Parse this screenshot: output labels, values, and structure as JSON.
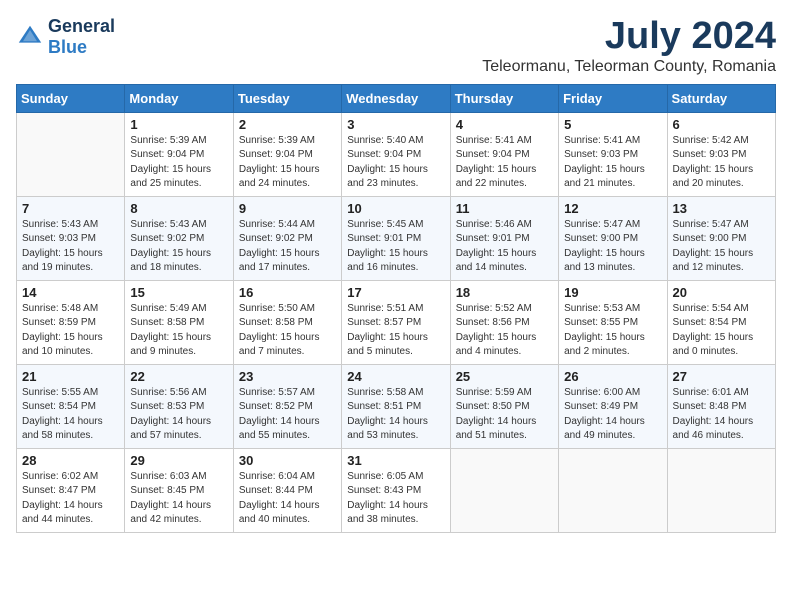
{
  "logo": {
    "general": "General",
    "blue": "Blue"
  },
  "title": "July 2024",
  "location": "Teleormanu, Teleorman County, Romania",
  "days_of_week": [
    "Sunday",
    "Monday",
    "Tuesday",
    "Wednesday",
    "Thursday",
    "Friday",
    "Saturday"
  ],
  "weeks": [
    [
      {
        "num": "",
        "info": ""
      },
      {
        "num": "1",
        "info": "Sunrise: 5:39 AM\nSunset: 9:04 PM\nDaylight: 15 hours\nand 25 minutes."
      },
      {
        "num": "2",
        "info": "Sunrise: 5:39 AM\nSunset: 9:04 PM\nDaylight: 15 hours\nand 24 minutes."
      },
      {
        "num": "3",
        "info": "Sunrise: 5:40 AM\nSunset: 9:04 PM\nDaylight: 15 hours\nand 23 minutes."
      },
      {
        "num": "4",
        "info": "Sunrise: 5:41 AM\nSunset: 9:04 PM\nDaylight: 15 hours\nand 22 minutes."
      },
      {
        "num": "5",
        "info": "Sunrise: 5:41 AM\nSunset: 9:03 PM\nDaylight: 15 hours\nand 21 minutes."
      },
      {
        "num": "6",
        "info": "Sunrise: 5:42 AM\nSunset: 9:03 PM\nDaylight: 15 hours\nand 20 minutes."
      }
    ],
    [
      {
        "num": "7",
        "info": "Sunrise: 5:43 AM\nSunset: 9:03 PM\nDaylight: 15 hours\nand 19 minutes."
      },
      {
        "num": "8",
        "info": "Sunrise: 5:43 AM\nSunset: 9:02 PM\nDaylight: 15 hours\nand 18 minutes."
      },
      {
        "num": "9",
        "info": "Sunrise: 5:44 AM\nSunset: 9:02 PM\nDaylight: 15 hours\nand 17 minutes."
      },
      {
        "num": "10",
        "info": "Sunrise: 5:45 AM\nSunset: 9:01 PM\nDaylight: 15 hours\nand 16 minutes."
      },
      {
        "num": "11",
        "info": "Sunrise: 5:46 AM\nSunset: 9:01 PM\nDaylight: 15 hours\nand 14 minutes."
      },
      {
        "num": "12",
        "info": "Sunrise: 5:47 AM\nSunset: 9:00 PM\nDaylight: 15 hours\nand 13 minutes."
      },
      {
        "num": "13",
        "info": "Sunrise: 5:47 AM\nSunset: 9:00 PM\nDaylight: 15 hours\nand 12 minutes."
      }
    ],
    [
      {
        "num": "14",
        "info": "Sunrise: 5:48 AM\nSunset: 8:59 PM\nDaylight: 15 hours\nand 10 minutes."
      },
      {
        "num": "15",
        "info": "Sunrise: 5:49 AM\nSunset: 8:58 PM\nDaylight: 15 hours\nand 9 minutes."
      },
      {
        "num": "16",
        "info": "Sunrise: 5:50 AM\nSunset: 8:58 PM\nDaylight: 15 hours\nand 7 minutes."
      },
      {
        "num": "17",
        "info": "Sunrise: 5:51 AM\nSunset: 8:57 PM\nDaylight: 15 hours\nand 5 minutes."
      },
      {
        "num": "18",
        "info": "Sunrise: 5:52 AM\nSunset: 8:56 PM\nDaylight: 15 hours\nand 4 minutes."
      },
      {
        "num": "19",
        "info": "Sunrise: 5:53 AM\nSunset: 8:55 PM\nDaylight: 15 hours\nand 2 minutes."
      },
      {
        "num": "20",
        "info": "Sunrise: 5:54 AM\nSunset: 8:54 PM\nDaylight: 15 hours\nand 0 minutes."
      }
    ],
    [
      {
        "num": "21",
        "info": "Sunrise: 5:55 AM\nSunset: 8:54 PM\nDaylight: 14 hours\nand 58 minutes."
      },
      {
        "num": "22",
        "info": "Sunrise: 5:56 AM\nSunset: 8:53 PM\nDaylight: 14 hours\nand 57 minutes."
      },
      {
        "num": "23",
        "info": "Sunrise: 5:57 AM\nSunset: 8:52 PM\nDaylight: 14 hours\nand 55 minutes."
      },
      {
        "num": "24",
        "info": "Sunrise: 5:58 AM\nSunset: 8:51 PM\nDaylight: 14 hours\nand 53 minutes."
      },
      {
        "num": "25",
        "info": "Sunrise: 5:59 AM\nSunset: 8:50 PM\nDaylight: 14 hours\nand 51 minutes."
      },
      {
        "num": "26",
        "info": "Sunrise: 6:00 AM\nSunset: 8:49 PM\nDaylight: 14 hours\nand 49 minutes."
      },
      {
        "num": "27",
        "info": "Sunrise: 6:01 AM\nSunset: 8:48 PM\nDaylight: 14 hours\nand 46 minutes."
      }
    ],
    [
      {
        "num": "28",
        "info": "Sunrise: 6:02 AM\nSunset: 8:47 PM\nDaylight: 14 hours\nand 44 minutes."
      },
      {
        "num": "29",
        "info": "Sunrise: 6:03 AM\nSunset: 8:45 PM\nDaylight: 14 hours\nand 42 minutes."
      },
      {
        "num": "30",
        "info": "Sunrise: 6:04 AM\nSunset: 8:44 PM\nDaylight: 14 hours\nand 40 minutes."
      },
      {
        "num": "31",
        "info": "Sunrise: 6:05 AM\nSunset: 8:43 PM\nDaylight: 14 hours\nand 38 minutes."
      },
      {
        "num": "",
        "info": ""
      },
      {
        "num": "",
        "info": ""
      },
      {
        "num": "",
        "info": ""
      }
    ]
  ]
}
